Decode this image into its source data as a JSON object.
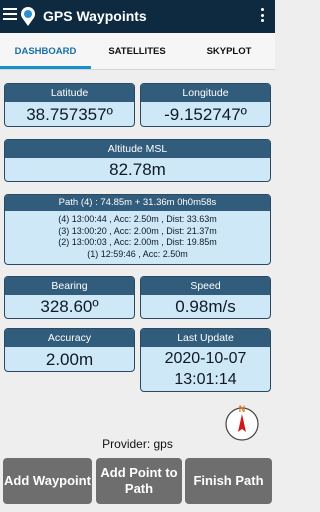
{
  "app": {
    "title": "GPS Waypoints"
  },
  "tabs": [
    {
      "label": "DASHBOARD",
      "active": true
    },
    {
      "label": "SATELLITES",
      "active": false
    },
    {
      "label": "SKYPLOT",
      "active": false
    }
  ],
  "latitude": {
    "label": "Latitude",
    "value": "38.757357º"
  },
  "longitude": {
    "label": "Longitude",
    "value": "-9.152747º"
  },
  "altitude": {
    "label": "Altitude MSL",
    "value": "82.78m"
  },
  "path": {
    "header": "Path (4) : 74.85m + 31.36m  0h0m58s",
    "lines": [
      "(4) 13:00:44 , Acc: 2.50m , Dist: 33.63m",
      "(3) 13:00:20 , Acc: 2.00m , Dist: 21.37m",
      "(2) 13:00:03 , Acc: 2.00m , Dist: 19.85m",
      "(1) 12:59:46 , Acc: 2.50m"
    ]
  },
  "bearing": {
    "label": "Bearing",
    "value": "328.60º"
  },
  "speed": {
    "label": "Speed",
    "value": "0.98m/s"
  },
  "accuracy": {
    "label": "Accuracy",
    "value": "2.00m"
  },
  "last_update": {
    "label": "Last Update",
    "date": "2020-10-07",
    "time": "13:01:14"
  },
  "compass": {
    "north_label": "N",
    "icon": "compass-icon"
  },
  "provider": {
    "text": "Provider: gps"
  },
  "buttons": {
    "add_waypoint": "Add Waypoint",
    "add_point": "Add Point to Path",
    "finish_path": "Finish Path"
  },
  "colors": {
    "appbar": "#0e2a40",
    "card_header": "#325c7c",
    "card_body": "#cfe8f8",
    "tab_active": "#1a6fa8",
    "button": "#6e6e6e"
  }
}
